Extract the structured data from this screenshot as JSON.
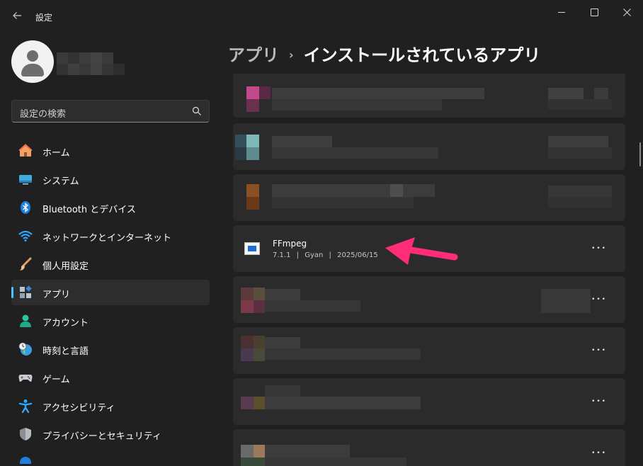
{
  "window": {
    "title": "設定"
  },
  "search": {
    "placeholder": "設定の検索"
  },
  "nav": [
    {
      "label": "ホーム",
      "icon": "home-icon"
    },
    {
      "label": "システム",
      "icon": "monitor-icon"
    },
    {
      "label": "Bluetooth とデバイス",
      "icon": "bluetooth-icon"
    },
    {
      "label": "ネットワークとインターネット",
      "icon": "wifi-icon"
    },
    {
      "label": "個人用設定",
      "icon": "brush-icon"
    },
    {
      "label": "アプリ",
      "icon": "apps-icon",
      "selected": true
    },
    {
      "label": "アカウント",
      "icon": "person-icon"
    },
    {
      "label": "時刻と言語",
      "icon": "clock-globe-icon"
    },
    {
      "label": "ゲーム",
      "icon": "gamepad-icon"
    },
    {
      "label": "アクセシビリティ",
      "icon": "accessibility-icon"
    },
    {
      "label": "プライバシーとセキュリティ",
      "icon": "shield-icon"
    }
  ],
  "breadcrumb": {
    "parent": "アプリ",
    "separator": "›",
    "current": "インストールされているアプリ"
  },
  "apps": {
    "featured": {
      "name": "FFmpeg",
      "version": "7.1.1",
      "publisher": "Gyan",
      "date": "2025/06/15",
      "separator": "|"
    },
    "more_label": "•••"
  },
  "colors": {
    "accent": "#4cc2ff",
    "background": "#202020",
    "card": "#2b2b2b",
    "annotation_arrow": "#ff2d78"
  }
}
